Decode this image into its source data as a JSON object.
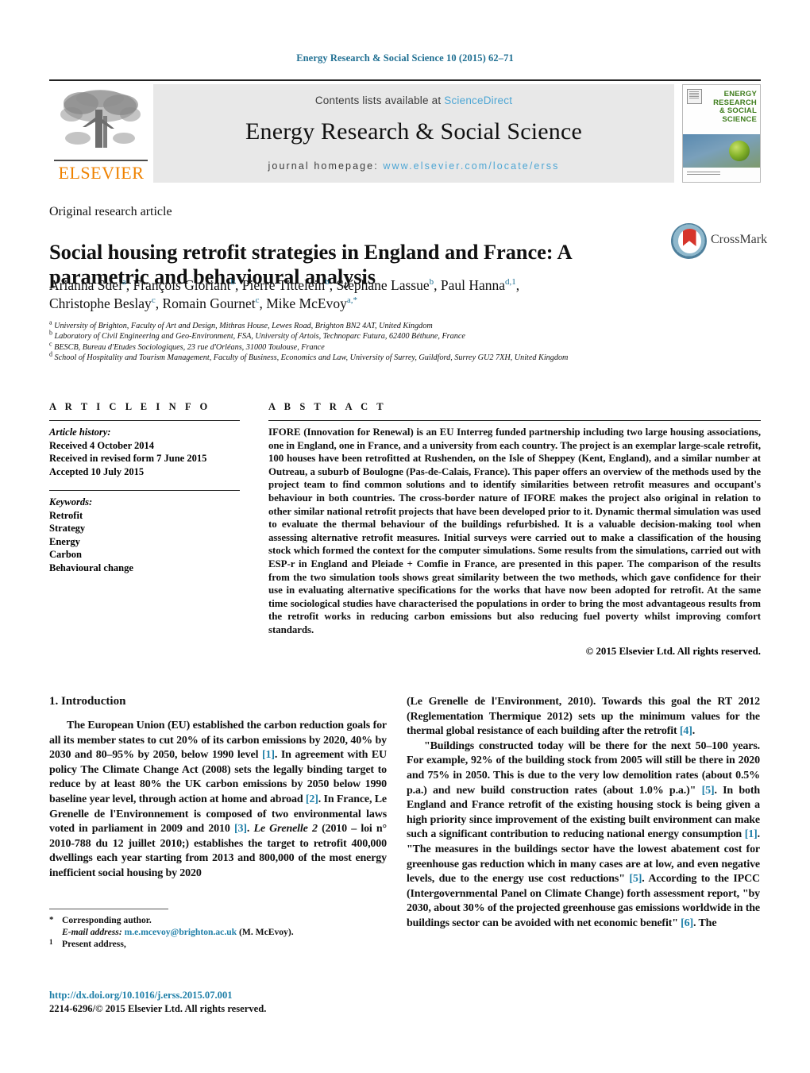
{
  "running_head": "Energy Research & Social Science 10 (2015) 62–71",
  "masthead": {
    "contents_prefix": "Contents lists available at ",
    "sciencedirect": "ScienceDirect",
    "journal_title": "Energy Research & Social Science",
    "homepage_prefix": "journal homepage: ",
    "homepage_url": "www.elsevier.com/locate/erss",
    "publisher": "ELSEVIER",
    "cover_title_line1": "ENERGY",
    "cover_title_line2": "RESEARCH",
    "cover_title_line3": "& SOCIAL",
    "cover_title_line4": "SCIENCE"
  },
  "article": {
    "type": "Original research article",
    "title": "Social housing retrofit strategies in England and France: A parametric and behavioural analysis",
    "crossmark_label": "CrossMark"
  },
  "authors": {
    "line1": "Arianna Sdei<sup>a</sup>, François Gloriant<sup>b</sup>, Pierre Tittelein<sup>b</sup>, Stéphane Lassue<sup>b</sup>, Paul Hanna<sup>d,1</sup>,",
    "line2": "Christophe Beslay<sup>c</sup>, Romain Gournet<sup>c</sup>, Mike McEvoy<sup>a,*</sup>"
  },
  "affiliations": [
    {
      "mark": "a",
      "text": "University of Brighton, Faculty of Art and Design, Mithras House, Lewes Road, Brighton BN2 4AT, United Kingdom"
    },
    {
      "mark": "b",
      "text": "Laboratory of Civil Engineering and Geo-Environment, FSA, University of Artois, Technoparc Futura, 62400 Béthune, France"
    },
    {
      "mark": "c",
      "text": "BESCB, Bureau d'Etudes Sociologiques, 23 rue d'Orléans, 31000 Toulouse, France"
    },
    {
      "mark": "d",
      "text": "School of Hospitality and Tourism Management, Faculty of Business, Economics and Law, University of Surrey, Guildford, Surrey GU2 7XH, United Kingdom"
    }
  ],
  "article_info": {
    "heading": "A R T I C L E  I N F O",
    "history_label": "Article history:",
    "history": [
      "Received 4 October 2014",
      "Received in revised form 7 June 2015",
      "Accepted 10 July 2015"
    ],
    "keywords_label": "Keywords:",
    "keywords": [
      "Retrofit",
      "Strategy",
      "Energy",
      "Carbon",
      "Behavioural change"
    ]
  },
  "abstract": {
    "heading": "A B S T R A C T",
    "body": "IFORE (Innovation for Renewal) is an EU Interreg funded partnership including two large housing associations, one in England, one in France, and a university from each country. The project is an exemplar large-scale retrofit, 100 houses have been retrofitted at Rushenden, on the Isle of Sheppey (Kent, England), and a similar number at Outreau, a suburb of Boulogne (Pas-de-Calais, France). This paper offers an overview of the methods used by the project team to find common solutions and to identify similarities between retrofit measures and occupant's behaviour in both countries. The cross-border nature of IFORE makes the project also original in relation to other similar national retrofit projects that have been developed prior to it. Dynamic thermal simulation was used to evaluate the thermal behaviour of the buildings refurbished. It is a valuable decision-making tool when assessing alternative retrofit measures. Initial surveys were carried out to make a classification of the housing stock which formed the context for the computer simulations. Some results from the simulations, carried out with ESP-r in England and Pleiade + Comfie in France, are presented in this paper. The comparison of the results from the two simulation tools shows great similarity between the two methods, which gave confidence for their use in evaluating alternative specifications for the works that have now been adopted for retrofit. At the same time sociological studies have characterised the populations in order to bring the most advantageous results from the retrofit works in reducing carbon emissions but also reducing fuel poverty whilst improving comfort standards.",
    "copyright": "© 2015 Elsevier Ltd. All rights reserved."
  },
  "intro": {
    "section_number_title": "1.  Introduction",
    "left_paragraph": "The European Union (EU) established the carbon reduction goals for all its member states to cut 20% of its carbon emissions by 2020, 40% by 2030 and 80–95% by 2050, below 1990 level [1]. In agreement with EU policy The Climate Change Act (2008) sets the legally binding target to reduce by at least 80% the UK carbon emissions by 2050 below 1990 baseline year level, through action at home and abroad [2]. In France, Le Grenelle de l'Environnement is composed of two environmental laws voted in parliament in 2009 and 2010 [3]. Le Grenelle 2 (2010 – loi n° 2010-788 du 12 juillet 2010;) establishes the target to retrofit 400,000 dwellings each year starting from 2013 and 800,000 of the most energy inefficient social housing by 2020",
    "right_paragraph_1": "(Le Grenelle de l'Environment, 2010). Towards this goal the RT 2012 (Reglementation Thermique 2012) sets up the minimum values for the thermal global resistance of each building after the retrofit [4].",
    "right_paragraph_2": "\"Buildings constructed today will be there for the next 50–100 years. For example, 92% of the building stock from 2005 will still be there in 2020 and 75% in 2050. This is due to the very low demolition rates (about 0.5% p.a.) and new build construction rates (about 1.0% p.a.)\" [5]. In both England and France retrofit of the existing housing stock is being given a high priority since improvement of the existing built environment can make such a significant contribution to reducing national energy consumption [1]. \"The measures in the buildings sector have the lowest abatement cost for greenhouse gas reduction which in many cases are at low, and even negative levels, due to the energy use cost reductions\" [5]. According to the IPCC (Intergovernmental Panel on Climate Change) forth assessment report, \"by 2030, about 30% of the projected greenhouse gas emissions worldwide in the buildings sector can be avoided with net economic benefit\" [6]. The"
  },
  "footnotes": {
    "corresponding_mark": "*",
    "corresponding_text": "Corresponding author.",
    "email_label": "E-mail address:",
    "email": "m.e.mcevoy@brighton.ac.uk",
    "email_suffix": "(M. McEvoy).",
    "present_mark": "1",
    "present_text": "Present address,"
  },
  "doi": {
    "link": "http://dx.doi.org/10.1016/j.erss.2015.07.001",
    "issn": "2214-6296/© 2015 Elsevier Ltd. All rights reserved."
  },
  "colors": {
    "link_blue": "#1f7fa8",
    "sciencedirect_blue": "#4ea6d4",
    "elsevier_orange": "#ef8200",
    "band_grey": "#e8e8e8",
    "crossmark_red": "#d6352b"
  }
}
